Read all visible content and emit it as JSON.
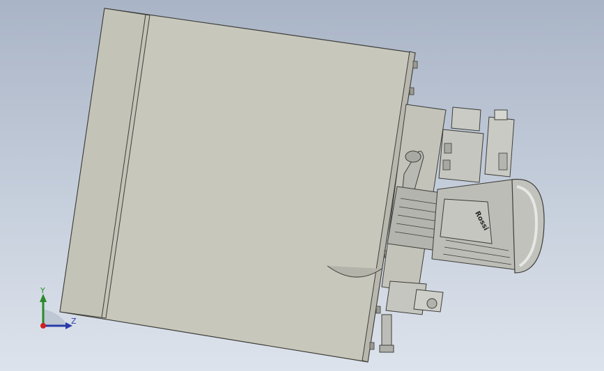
{
  "viewport": {
    "background_top": "#a9b4c6",
    "background_bottom": "#dde3ec"
  },
  "model": {
    "description_parts": [
      "reservoir-tank",
      "motor",
      "pump",
      "valve-block",
      "solenoid-valve",
      "pipe-elbow"
    ],
    "tank_color": "#c9c8bd",
    "motor_color": "#b8b8b4",
    "brand_label": "Rossi"
  },
  "triad": {
    "y_label": "Y",
    "z_label": "Z",
    "y_color": "#2a8a2a",
    "z_color": "#2a3aa8",
    "origin_color": "#d02020"
  }
}
